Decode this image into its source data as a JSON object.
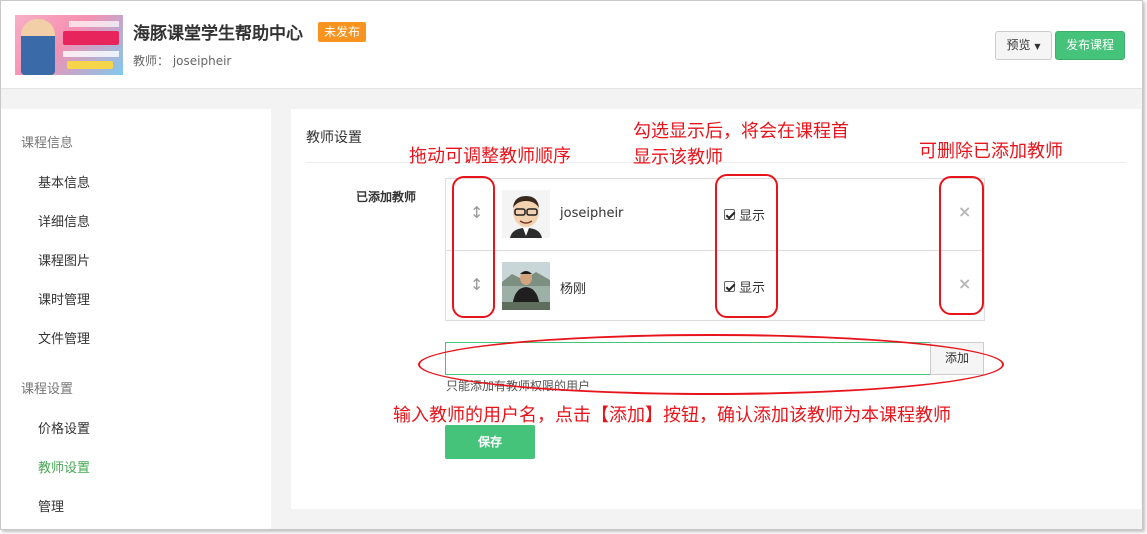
{
  "header": {
    "course_title": "海豚课堂学生帮助中心",
    "status": "未发布",
    "teacher_label": "教师：",
    "teacher_name": "joseipheir",
    "preview_label": "预览",
    "publish_label": "发布课程"
  },
  "sidebar": {
    "group1": "课程信息",
    "group1_items": [
      "基本信息",
      "详细信息",
      "课程图片",
      "课时管理",
      "文件管理"
    ],
    "group2": "课程设置",
    "group2_items": [
      "价格设置",
      "教师设置",
      "管理"
    ],
    "active_item": "教师设置"
  },
  "content": {
    "title": "教师设置",
    "added_label": "已添加教师",
    "teachers": [
      {
        "name": "joseipheir",
        "show_label": "显示",
        "shown": true
      },
      {
        "name": "杨刚",
        "show_label": "显示",
        "shown": true
      }
    ],
    "input_value": "",
    "add_label": "添加",
    "hint": "只能添加有教师权限的用户",
    "save_label": "保存"
  },
  "annotations": {
    "drag": "拖动可调整教师顺序",
    "show_line1": "勾选显示后，将会在课程首",
    "show_line2": "显示该教师",
    "delete": "可删除已添加教师",
    "add": "输入教师的用户名，点击【添加】按钮，确认添加该教师为本课程教师"
  },
  "colors": {
    "accent": "#46c37b",
    "status": "#f7931e",
    "annotation": "#e8141b"
  }
}
